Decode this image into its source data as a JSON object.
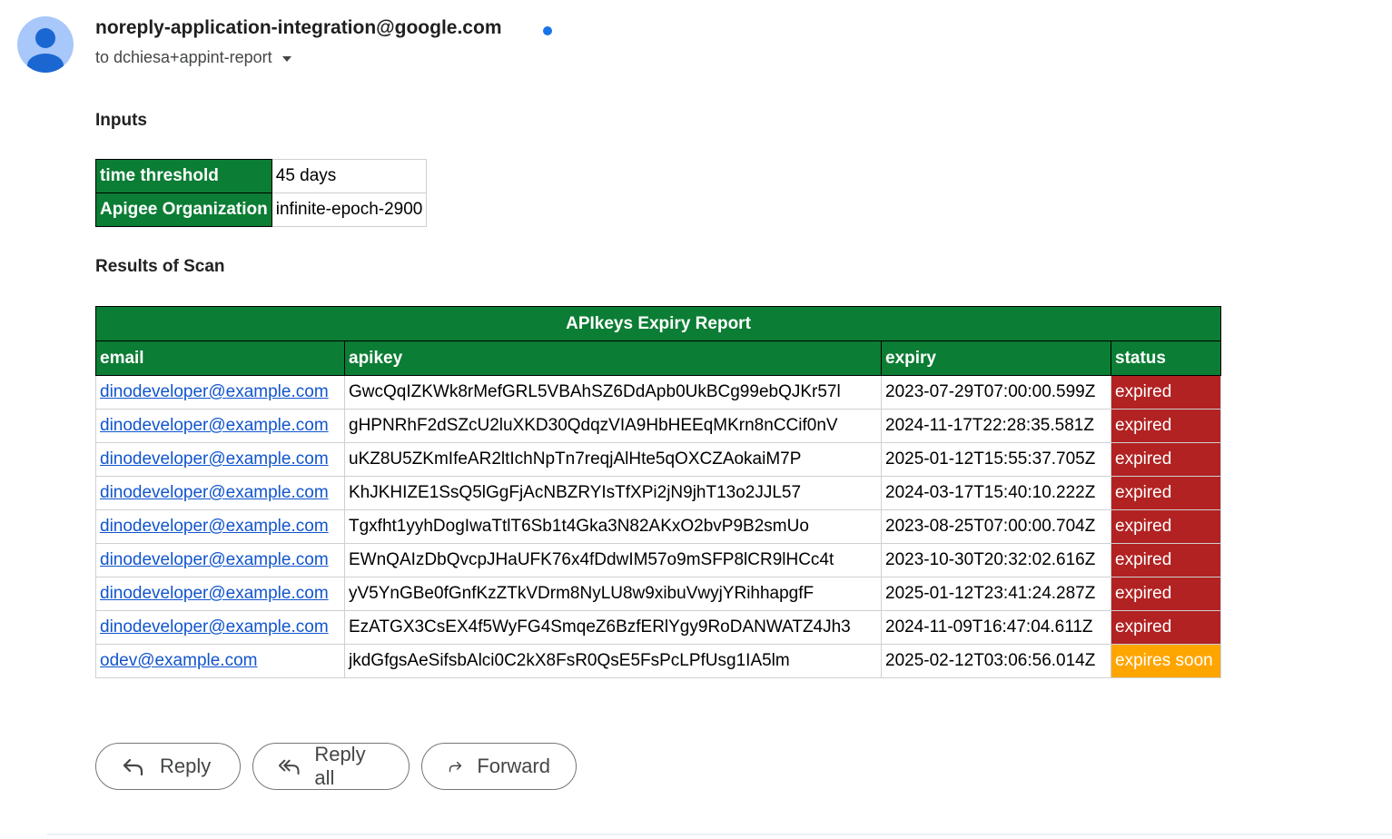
{
  "header": {
    "sender": "noreply-application-integration@google.com",
    "recipient": "to dchiesa+appint-report",
    "unread_color": "#1a73e8"
  },
  "inputs": {
    "heading": "Inputs",
    "rows": [
      {
        "key": "time threshold",
        "value": "45 days"
      },
      {
        "key": "Apigee Organization",
        "value": "infinite-epoch-2900"
      }
    ]
  },
  "results": {
    "heading": "Results of Scan",
    "table_title": "APIkeys Expiry Report",
    "columns": [
      "email",
      "apikey",
      "expiry",
      "status"
    ],
    "rows": [
      {
        "email": "dinodeveloper@example.com",
        "apikey": "GwcQqIZKWk8rMefGRL5VBAhSZ6DdApb0UkBCg99ebQJKr57l",
        "expiry": "2023-07-29T07:00:00.599Z",
        "status": "expired",
        "status_color": "#b22222"
      },
      {
        "email": "dinodeveloper@example.com",
        "apikey": "gHPNRhF2dSZcU2luXKD30QdqzVIA9HbHEEqMKrn8nCCif0nV",
        "expiry": "2024-11-17T22:28:35.581Z",
        "status": "expired",
        "status_color": "#b22222"
      },
      {
        "email": "dinodeveloper@example.com",
        "apikey": "uKZ8U5ZKmIfeAR2ltIchNpTn7reqjAlHte5qOXCZAokaiM7P",
        "expiry": "2025-01-12T15:55:37.705Z",
        "status": "expired",
        "status_color": "#b22222"
      },
      {
        "email": "dinodeveloper@example.com",
        "apikey": "KhJKHIZE1SsQ5lGgFjAcNBZRYIsTfXPi2jN9jhT13o2JJL57",
        "expiry": "2024-03-17T15:40:10.222Z",
        "status": "expired",
        "status_color": "#b22222"
      },
      {
        "email": "dinodeveloper@example.com",
        "apikey": "Tgxfht1yyhDogIwaTtlT6Sb1t4Gka3N82AKxO2bvP9B2smUo",
        "expiry": "2023-08-25T07:00:00.704Z",
        "status": "expired",
        "status_color": "#b22222"
      },
      {
        "email": "dinodeveloper@example.com",
        "apikey": "EWnQAIzDbQvcpJHaUFK76x4fDdwIM57o9mSFP8lCR9lHCc4t",
        "expiry": "2023-10-30T20:32:02.616Z",
        "status": "expired",
        "status_color": "#b22222"
      },
      {
        "email": "dinodeveloper@example.com",
        "apikey": "yV5YnGBe0fGnfKzZTkVDrm8NyLU8w9xibuVwyjYRihhapgfF",
        "expiry": "2025-01-12T23:41:24.287Z",
        "status": "expired",
        "status_color": "#b22222"
      },
      {
        "email": "dinodeveloper@example.com",
        "apikey": "EzATGX3CsEX4f5WyFG4SmqeZ6BzfERlYgy9RoDANWATZ4Jh3",
        "expiry": "2024-11-09T16:47:04.611Z",
        "status": "expired",
        "status_color": "#b22222"
      },
      {
        "email": "odev@example.com",
        "apikey": "jkdGfgsAeSifsbAlci0C2kX8FsR0QsE5FsPcLPfUsg1IA5lm",
        "expiry": "2025-02-12T03:06:56.014Z",
        "status": "expires soon",
        "status_color": "#ffa500"
      }
    ],
    "header_color": "#0b7d34"
  },
  "actions": {
    "reply": {
      "label": "Reply",
      "icon": "reply-icon"
    },
    "reply_all": {
      "label": "Reply all",
      "icon": "reply-all-icon"
    },
    "forward": {
      "label": "Forward",
      "icon": "forward-icon"
    }
  }
}
